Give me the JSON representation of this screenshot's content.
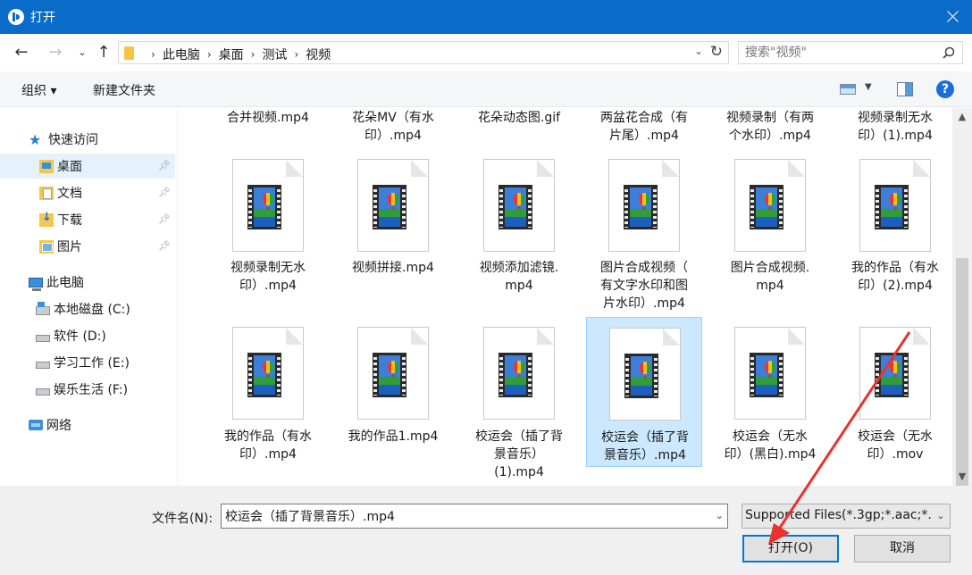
{
  "window": {
    "title": "打开"
  },
  "breadcrumbs": [
    "此电脑",
    "桌面",
    "测试",
    "视频"
  ],
  "search": {
    "placeholder": "搜索\"视频\""
  },
  "toolbar": {
    "organize": "组织 ▾",
    "new_folder": "新建文件夹",
    "help": "?"
  },
  "sidebar": {
    "quick_access": "快速访问",
    "items": [
      {
        "label": "桌面",
        "icon": "desktop-folder-icon",
        "pinned": true,
        "selected": true
      },
      {
        "label": "文档",
        "icon": "documents-folder-icon",
        "pinned": true
      },
      {
        "label": "下载",
        "icon": "downloads-folder-icon",
        "pinned": true
      },
      {
        "label": "图片",
        "icon": "pictures-folder-icon",
        "pinned": true
      }
    ],
    "this_pc": "此电脑",
    "drives": [
      {
        "label": "本地磁盘 (C:)",
        "icon": "system-drive-icon"
      },
      {
        "label": "软件 (D:)",
        "icon": "drive-icon"
      },
      {
        "label": "学习工作 (E:)",
        "icon": "drive-icon"
      },
      {
        "label": "娱乐生活 (F:)",
        "icon": "drive-icon"
      }
    ],
    "network": "网络"
  },
  "files": {
    "top_partial": [
      "合并视频.mp4",
      "花朵MV（有水印）.mp4",
      "花朵动态图.gif",
      "两盆花合成（有片尾）.mp4",
      "视频录制（有两个水印）.mp4",
      "视频录制无水印）(1).mp4"
    ],
    "row2": [
      "视频录制无水印）.mp4",
      "视频拼接.mp4",
      "视频添加滤镜.mp4",
      "图片合成视频（有文字水印和图片水印）.mp4",
      "图片合成视频.mp4",
      "我的作品（有水印）(2).mp4"
    ],
    "row3": [
      "我的作品（有水印）.mp4",
      "我的作品1.mp4",
      "校运会（插了背景音乐）(1).mp4",
      "校运会（插了背景音乐）.mp4",
      "校运会（无水印）(黑白).mp4",
      "校运会（无水印）.mov"
    ],
    "selected": "校运会（插了背景音乐）.mp4"
  },
  "labels_split": {
    "top": [
      [
        "合并视频.mp4"
      ],
      [
        "花朵MV（有水",
        "印）.mp4"
      ],
      [
        "花朵动态图.gif"
      ],
      [
        "两盆花合成（有",
        "片尾）.mp4"
      ],
      [
        "视频录制（有两",
        "个水印）.mp4"
      ],
      [
        "视频录制无水",
        "印）(1).mp4"
      ]
    ],
    "r2": [
      [
        "视频录制无水",
        "印）.mp4"
      ],
      [
        "视频拼接.mp4"
      ],
      [
        "视频添加滤镜.",
        "mp4"
      ],
      [
        "图片合成视频（",
        "有文字水印和图",
        "片水印）.mp4"
      ],
      [
        "图片合成视频.",
        "mp4"
      ],
      [
        "我的作品（有水",
        "印）(2).mp4"
      ]
    ],
    "r3": [
      [
        "我的作品（有水",
        "印）.mp4"
      ],
      [
        "我的作品1.mp4"
      ],
      [
        "校运会（插了背",
        "景音乐）",
        "(1).mp4"
      ],
      [
        "校运会（插了背",
        "景音乐）.mp4"
      ],
      [
        "校运会（无水",
        "印）(黑白).mp4"
      ],
      [
        "校运会（无水",
        "印）.mov"
      ]
    ]
  },
  "footer": {
    "filename_label": "文件名(N):",
    "filename_value": "校运会（插了背景音乐）.mp4",
    "filetype_value": "Supported Files(*.3gp;*.aac;*.",
    "open_label": "打开(O)",
    "cancel_label": "取消"
  },
  "colors": {
    "titlebar": "#0a6bc9",
    "selection": "#cce8ff",
    "annotation_arrow": "#e8322d"
  }
}
